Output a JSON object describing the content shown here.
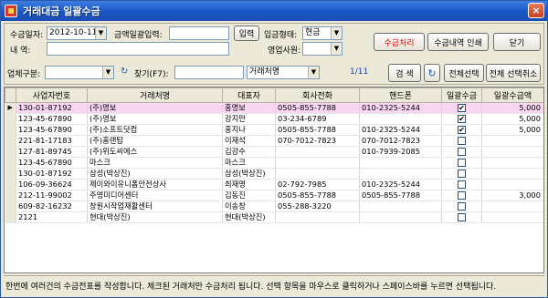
{
  "window": {
    "title": "거래대금 일괄수금",
    "close": "×"
  },
  "form": {
    "date_label": "수금일자:",
    "date_value": "2012-10-11",
    "amount_label": "금액일괄입력:",
    "amount_value": "",
    "input_button": "입력",
    "type_label": "입금형태:",
    "type_value": "현금",
    "memo_label": "내  역:",
    "memo_value": "",
    "sales_label": "영업사원:",
    "sales_value": "",
    "collect_button": "수금처리",
    "print_button": "수금내역 인쇄",
    "close_button": "닫기"
  },
  "filter": {
    "category_label": "업체구분:",
    "category_value": "",
    "find_label": "찾기(F7):",
    "find_value": "",
    "find_field_value": "거래처명",
    "count": "1/11",
    "search_button": "검 색",
    "select_all_button": "전체선택",
    "deselect_all_button": "전체 선택취소"
  },
  "table": {
    "columns": [
      "사업자번호",
      "거래처명",
      "대표자",
      "회사전화",
      "핸드폰",
      "일괄수금",
      "일괄수금액"
    ],
    "rows": [
      {
        "biz": "130-01-87192",
        "name": "(주)명보",
        "ceo": "홍명보",
        "tel": "0505-855-7788",
        "mobile": "010-2325-5244",
        "checked": true,
        "amount": "5,000",
        "selected": true
      },
      {
        "biz": "123-45-67890",
        "name": "(주)명보",
        "ceo": "강지만",
        "tel": "03-234-6789",
        "mobile": "",
        "checked": true,
        "amount": "5,000",
        "selected": false
      },
      {
        "biz": "123-45-67890",
        "name": "(주)소프트닷컴",
        "ceo": "홍지나",
        "tel": "0505-855-7788",
        "mobile": "010-2325-5244",
        "checked": true,
        "amount": "5,000",
        "selected": false
      },
      {
        "biz": "221-81-17183",
        "name": "(주)홈랜탑",
        "ceo": "이재석",
        "tel": "070-7012-7823",
        "mobile": "070-7012-7823",
        "checked": false,
        "amount": "",
        "selected": false
      },
      {
        "biz": "127-81-89745",
        "name": "(주)위도씨에스",
        "ceo": "김강수",
        "tel": "",
        "mobile": "010-7939-2085",
        "checked": false,
        "amount": "",
        "selected": false
      },
      {
        "biz": "123-45-67890",
        "name": "마스크",
        "ceo": "마스크",
        "tel": "",
        "mobile": "",
        "checked": false,
        "amount": "",
        "selected": false
      },
      {
        "biz": "130-01-87192",
        "name": "삼성(박상진)",
        "ceo": "삼성(박상진)",
        "tel": "",
        "mobile": "",
        "checked": false,
        "amount": "",
        "selected": false
      },
      {
        "biz": "106-09-36624",
        "name": "제이와이유니폼안전상사",
        "ceo": "최재영",
        "tel": "02-792-7985",
        "mobile": "010-2325-5244",
        "checked": false,
        "amount": "",
        "selected": false
      },
      {
        "biz": "212-11-99002",
        "name": "주영미디어센터",
        "ceo": "김동진",
        "tel": "0505-855-7788",
        "mobile": "0505-855-7788",
        "checked": false,
        "amount": "3,000",
        "selected": false
      },
      {
        "biz": "609-82-16232",
        "name": "창원시작업재활센터",
        "ceo": "이송창",
        "tel": "055-288-3220",
        "mobile": "",
        "checked": false,
        "amount": "",
        "selected": false
      },
      {
        "biz": "2121",
        "name": "현대(박상진)",
        "ceo": "현대(박상진)",
        "tel": "",
        "mobile": "",
        "checked": false,
        "amount": "",
        "selected": false
      }
    ]
  },
  "status": "한번에 여러건의 수금전표를 작성합니다. 체크된 거래처만 수금처리 됩니다. 선택 항목을 마우스로 클릭하거나 스페이스바를 누르면 선택됩니다."
}
